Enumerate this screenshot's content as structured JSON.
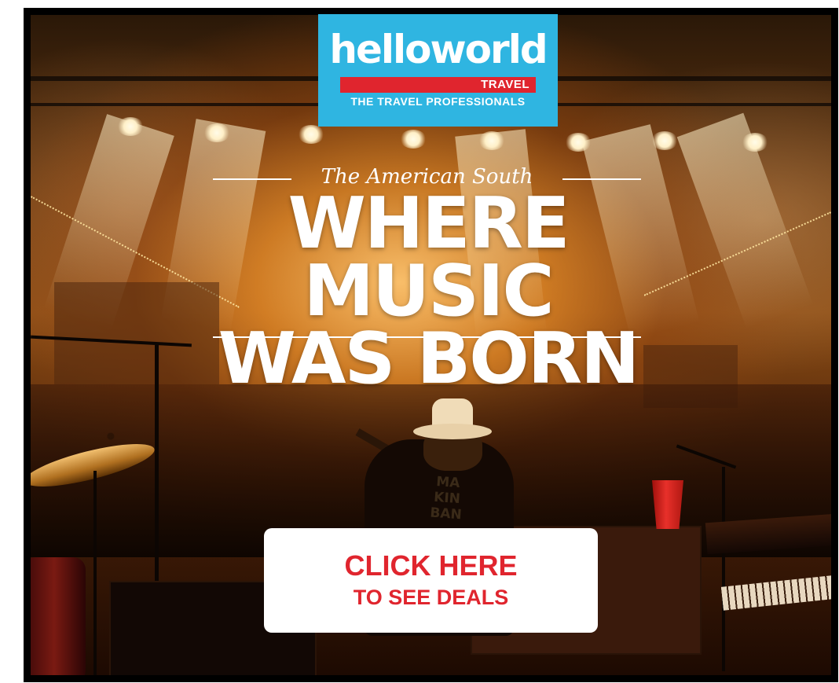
{
  "logo": {
    "wordmark": "helloworld",
    "badge": "TRAVEL",
    "tagline": "THE TRAVEL PROFESSIONALS"
  },
  "ad": {
    "subheading": "The American South",
    "headline_line1": "WHERE MUSIC",
    "headline_line2": "WAS BORN"
  },
  "cta": {
    "line1": "CLICK HERE",
    "line2": "TO SEE DEALS"
  },
  "photo": {
    "shirt_text": "MA\nKIN\nBAN"
  },
  "colors": {
    "logo_blue": "#2fb5e1",
    "brand_red": "#e0252e",
    "frame": "#000000"
  }
}
